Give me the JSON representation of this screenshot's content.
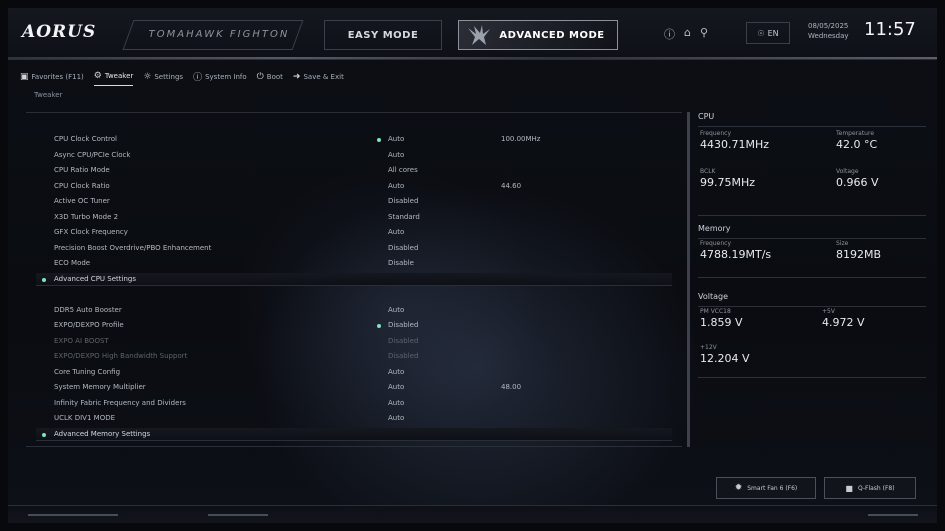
{
  "header": {
    "brand": "AORUS",
    "board_name": "TOMAHAWK FIGHTON",
    "easy_mode": "EASY MODE",
    "advanced_mode": "ADVANCED MODE",
    "language": "EN",
    "date": "08/05/2025",
    "weekday": "Wednesday",
    "time": "11:57"
  },
  "tabs": [
    {
      "label": "Favorites (F11)",
      "icon": "star-icon"
    },
    {
      "label": "Tweaker",
      "icon": "tweaker-icon",
      "active": true
    },
    {
      "label": "Settings",
      "icon": "gear-icon"
    },
    {
      "label": "System Info",
      "icon": "info-icon"
    },
    {
      "label": "Boot",
      "icon": "power-icon"
    },
    {
      "label": "Save & Exit",
      "icon": "exit-icon"
    }
  ],
  "breadcrumb": "Tweaker",
  "settings": [
    {
      "label": "CPU Clock Control",
      "value": "Auto",
      "value2": "100.00MHz",
      "dot": true
    },
    {
      "label": "Async CPU/PCIe Clock",
      "value": "Auto"
    },
    {
      "label": "CPU Ratio Mode",
      "value": "All cores"
    },
    {
      "label": "CPU Clock Ratio",
      "value": "Auto",
      "value2": "44.60"
    },
    {
      "label": "Active OC Tuner",
      "value": "Disabled"
    },
    {
      "label": "X3D Turbo Mode 2",
      "value": "Standard"
    },
    {
      "label": "GFX Clock Frequency",
      "value": "Auto"
    },
    {
      "label": "Precision Boost Overdrive/PBO Enhancement",
      "value": "Disabled"
    },
    {
      "label": "ECO Mode",
      "value": "Disable"
    },
    {
      "label": "Advanced CPU Settings",
      "header": true
    },
    {
      "label": "",
      "spacer": true
    },
    {
      "label": "DDR5 Auto Booster",
      "value": "Auto"
    },
    {
      "label": "EXPO/DEXPO Profile",
      "value": "Disabled",
      "dot": true
    },
    {
      "label": "EXPO AI BOOST",
      "value": "Disabled",
      "disabled": true
    },
    {
      "label": "EXPO/DEXPO High Bandwidth Support",
      "value": "Disabled",
      "disabled": true
    },
    {
      "label": "Core Tuning Config",
      "value": "Auto"
    },
    {
      "label": "System Memory Multiplier",
      "value": "Auto",
      "value2": "48.00"
    },
    {
      "label": "Infinity Fabric Frequency and Dividers",
      "value": "Auto"
    },
    {
      "label": "UCLK DIV1 MODE",
      "value": "Auto"
    },
    {
      "label": "Advanced Memory Settings",
      "header": true
    }
  ],
  "info": {
    "cpu": {
      "title": "CPU",
      "frequency_label": "Frequency",
      "frequency": "4430.71MHz",
      "temperature_label": "Temperature",
      "temperature": "42.0 °C",
      "bclk_label": "BCLK",
      "bclk": "99.75MHz",
      "voltage_label": "Voltage",
      "voltage": "0.966 V"
    },
    "memory": {
      "title": "Memory",
      "frequency_label": "Frequency",
      "frequency": "4788.19MT/s",
      "size_label": "Size",
      "size": "8192MB"
    },
    "voltage": {
      "title": "Voltage",
      "a_label": "PM VCC18",
      "a": "1.859 V",
      "b_label": "+5V",
      "b": "4.972 V",
      "c_label": "+12V",
      "c": "12.204 V"
    }
  },
  "buttons": {
    "smart_fan": "Smart Fan 6 (F6)",
    "qflash": "Q-Flash (F8)"
  }
}
